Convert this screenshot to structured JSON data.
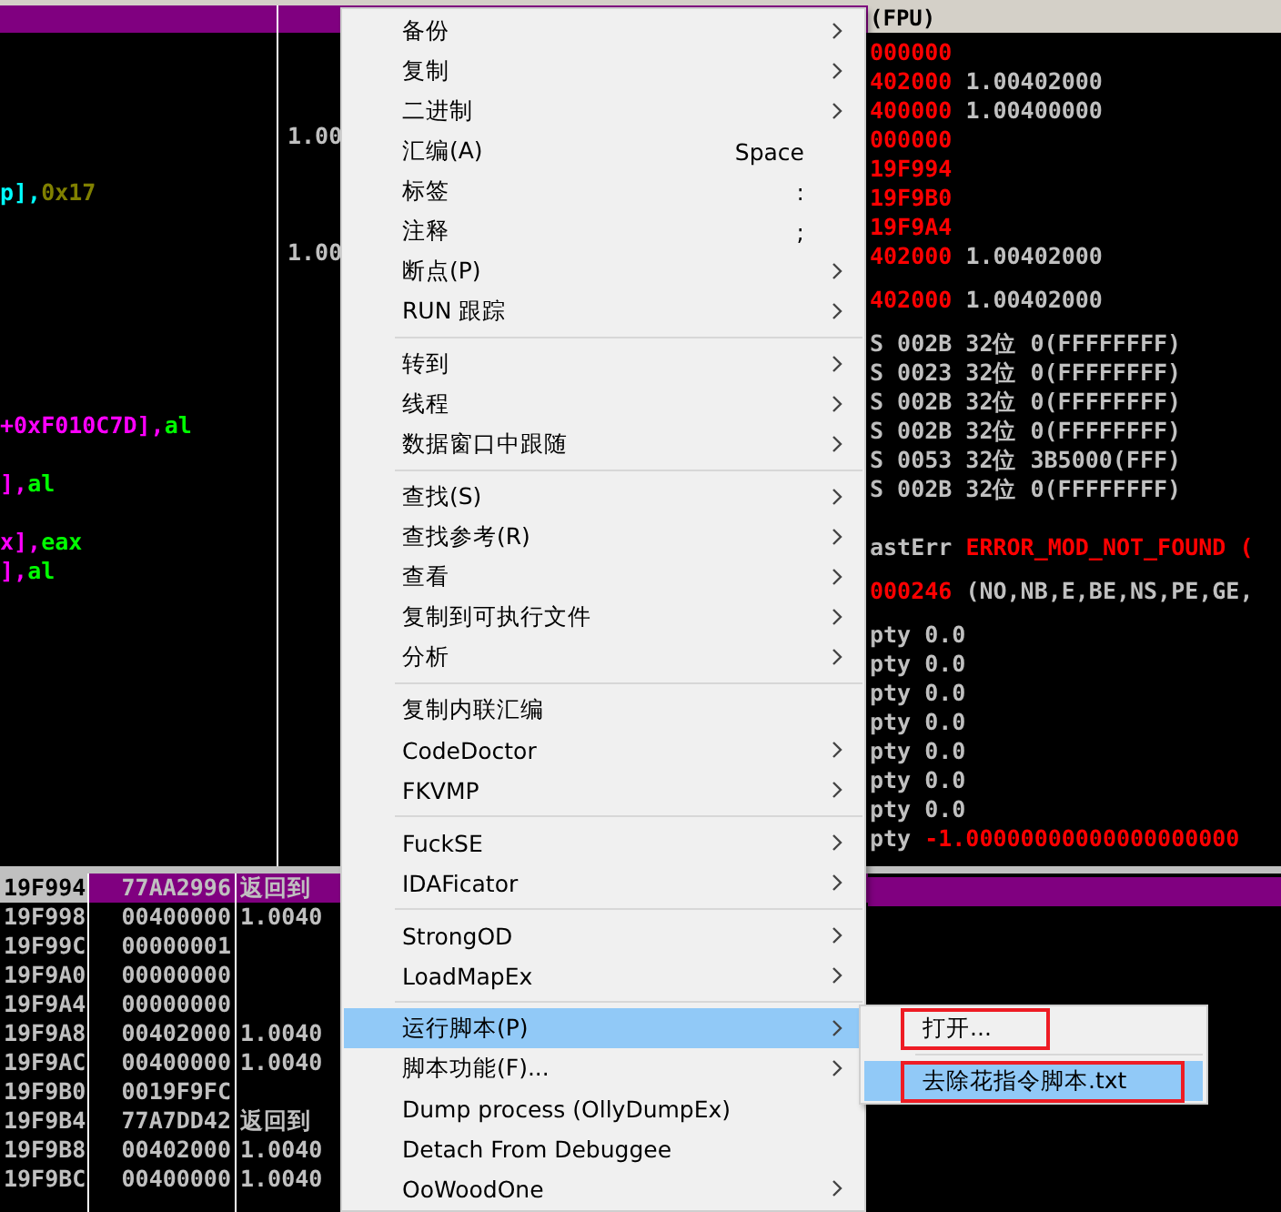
{
  "disassembly": {
    "lines": [
      {
        "kind": "blank"
      },
      {
        "kind": "blank"
      },
      {
        "kind": "blank"
      },
      {
        "kind": "blank"
      },
      {
        "kind": "blank"
      },
      {
        "kind": "code",
        "parts": [
          {
            "text": "p],",
            "color": "#00ffff"
          },
          {
            "text": "0x17",
            "color": "#808000"
          }
        ]
      },
      {
        "kind": "blank"
      },
      {
        "kind": "blank"
      },
      {
        "kind": "blank"
      },
      {
        "kind": "blank"
      },
      {
        "kind": "blank"
      },
      {
        "kind": "blank"
      },
      {
        "kind": "blank"
      },
      {
        "kind": "code",
        "parts": [
          {
            "text": "+0xF010C7D],",
            "color": "#ff00ff"
          },
          {
            "text": "al",
            "color": "#00ff00"
          }
        ]
      },
      {
        "kind": "blank"
      },
      {
        "kind": "code",
        "parts": [
          {
            "text": "],",
            "color": "#ff00ff"
          },
          {
            "text": "al",
            "color": "#00ff00"
          }
        ]
      },
      {
        "kind": "blank"
      },
      {
        "kind": "code",
        "parts": [
          {
            "text": "x],",
            "color": "#ff00ff"
          },
          {
            "text": "eax",
            "color": "#00ff00"
          }
        ]
      },
      {
        "kind": "code",
        "parts": [
          {
            "text": "],",
            "color": "#ff00ff"
          },
          {
            "text": "al",
            "color": "#00ff00"
          }
        ]
      }
    ]
  },
  "info_pane": {
    "lines": [
      {
        "kind": "blank"
      },
      {
        "kind": "blank"
      },
      {
        "kind": "blank"
      },
      {
        "kind": "code",
        "parts": [
          {
            "text": "1.00",
            "color": "#c0c0c0"
          }
        ]
      },
      {
        "kind": "blank"
      },
      {
        "kind": "blank"
      },
      {
        "kind": "blank"
      },
      {
        "kind": "code",
        "parts": [
          {
            "text": "1.00",
            "color": "#c0c0c0"
          }
        ]
      }
    ]
  },
  "registers": {
    "header": "(FPU)",
    "lines": [
      {
        "kind": "code",
        "parts": [
          {
            "text": "000000",
            "color": "#ff0000"
          }
        ]
      },
      {
        "kind": "code",
        "parts": [
          {
            "text": "402000 ",
            "color": "#ff0000"
          },
          {
            "text": "1.00402000",
            "color": "#c0c0c0"
          }
        ]
      },
      {
        "kind": "code",
        "parts": [
          {
            "text": "400000 ",
            "color": "#ff0000"
          },
          {
            "text": "1.00400000",
            "color": "#c0c0c0"
          }
        ]
      },
      {
        "kind": "code",
        "parts": [
          {
            "text": "000000",
            "color": "#ff0000"
          }
        ]
      },
      {
        "kind": "code",
        "parts": [
          {
            "text": "19F994",
            "color": "#ff0000"
          }
        ]
      },
      {
        "kind": "code",
        "parts": [
          {
            "text": "19F9B0",
            "color": "#ff0000"
          }
        ]
      },
      {
        "kind": "code",
        "parts": [
          {
            "text": "19F9A4",
            "color": "#ff0000"
          }
        ]
      },
      {
        "kind": "code",
        "parts": [
          {
            "text": "402000 ",
            "color": "#ff0000"
          },
          {
            "text": "1.00402000",
            "color": "#c0c0c0"
          }
        ]
      },
      {
        "kind": "gap"
      },
      {
        "kind": "code",
        "parts": [
          {
            "text": "402000 ",
            "color": "#ff0000"
          },
          {
            "text": "1.00402000",
            "color": "#c0c0c0"
          }
        ]
      },
      {
        "kind": "gap"
      },
      {
        "kind": "code",
        "parts": [
          {
            "text": "S 002B 32位 0(FFFFFFFF)",
            "color": "#c0c0c0"
          }
        ]
      },
      {
        "kind": "code",
        "parts": [
          {
            "text": "S 0023 32位 0(FFFFFFFF)",
            "color": "#c0c0c0"
          }
        ]
      },
      {
        "kind": "code",
        "parts": [
          {
            "text": "S 002B 32位 0(FFFFFFFF)",
            "color": "#c0c0c0"
          }
        ]
      },
      {
        "kind": "code",
        "parts": [
          {
            "text": "S 002B 32位 0(FFFFFFFF)",
            "color": "#c0c0c0"
          }
        ]
      },
      {
        "kind": "code",
        "parts": [
          {
            "text": "S 0053 32位 3B5000(FFF)",
            "color": "#c0c0c0"
          }
        ]
      },
      {
        "kind": "code",
        "parts": [
          {
            "text": "S 002B 32位 0(FFFFFFFF)",
            "color": "#c0c0c0"
          }
        ]
      },
      {
        "kind": "blank"
      },
      {
        "kind": "code",
        "parts": [
          {
            "text": "astErr ",
            "color": "#c0c0c0"
          },
          {
            "text": "ERROR_MOD_NOT_FOUND (",
            "color": "#ff0000"
          }
        ]
      },
      {
        "kind": "gap"
      },
      {
        "kind": "code",
        "parts": [
          {
            "text": "000246 ",
            "color": "#ff0000"
          },
          {
            "text": "(NO,NB,E,BE,NS,PE,GE,",
            "color": "#c0c0c0"
          }
        ]
      },
      {
        "kind": "gap"
      },
      {
        "kind": "code",
        "parts": [
          {
            "text": "pty 0.0",
            "color": "#c0c0c0"
          }
        ]
      },
      {
        "kind": "code",
        "parts": [
          {
            "text": "pty 0.0",
            "color": "#c0c0c0"
          }
        ]
      },
      {
        "kind": "code",
        "parts": [
          {
            "text": "pty 0.0",
            "color": "#c0c0c0"
          }
        ]
      },
      {
        "kind": "code",
        "parts": [
          {
            "text": "pty 0.0",
            "color": "#c0c0c0"
          }
        ]
      },
      {
        "kind": "code",
        "parts": [
          {
            "text": "pty 0.0",
            "color": "#c0c0c0"
          }
        ]
      },
      {
        "kind": "code",
        "parts": [
          {
            "text": "pty 0.0",
            "color": "#c0c0c0"
          }
        ]
      },
      {
        "kind": "code",
        "parts": [
          {
            "text": "pty 0.0",
            "color": "#c0c0c0"
          }
        ]
      },
      {
        "kind": "code",
        "parts": [
          {
            "text": "pty ",
            "color": "#c0c0c0"
          },
          {
            "text": "-1.00000000000000000000",
            "color": "#ff0000"
          }
        ]
      }
    ]
  },
  "stack": {
    "rows": [
      {
        "address": "19F994",
        "value": "77AA2996",
        "comment": "返回到",
        "selected": true
      },
      {
        "address": "19F998",
        "value": "00400000",
        "comment": "1.0040",
        "selected": false
      },
      {
        "address": "19F99C",
        "value": "00000001",
        "selected": false
      },
      {
        "address": "19F9A0",
        "value": "00000000",
        "selected": false
      },
      {
        "address": "19F9A4",
        "value": "00000000",
        "selected": false
      },
      {
        "address": "19F9A8",
        "value": "00402000",
        "comment": "1.0040",
        "selected": false
      },
      {
        "address": "19F9AC",
        "value": "00400000",
        "comment": "1.0040",
        "selected": false
      },
      {
        "address": "19F9B0",
        "value": "0019F9FC",
        "selected": false
      },
      {
        "address": "19F9B4",
        "value": "77A7DD42",
        "comment": "返回到",
        "selected": false
      },
      {
        "address": "19F9B8",
        "value": "00402000",
        "comment": "1.0040",
        "selected": false
      },
      {
        "address": "19F9BC",
        "value": "00400000",
        "comment": "1.0040",
        "selected": false
      }
    ]
  },
  "context_menu": {
    "items": [
      {
        "kind": "item",
        "label": "备份",
        "submenu": true,
        "selected": false
      },
      {
        "kind": "item",
        "label": "复制",
        "submenu": true,
        "selected": false
      },
      {
        "kind": "item",
        "label": "二进制",
        "submenu": true,
        "selected": false
      },
      {
        "kind": "item",
        "label": "汇编(A)",
        "shortcut": "Space",
        "submenu": false,
        "selected": false
      },
      {
        "kind": "item",
        "label": "标签",
        "shortcut": ":",
        "submenu": false,
        "selected": false
      },
      {
        "kind": "item",
        "label": "注释",
        "shortcut": ";",
        "submenu": false,
        "selected": false
      },
      {
        "kind": "item",
        "label": "断点(P)",
        "submenu": true,
        "selected": false
      },
      {
        "kind": "item",
        "label": "RUN 跟踪",
        "submenu": true,
        "selected": false
      },
      {
        "kind": "separator"
      },
      {
        "kind": "item",
        "label": "转到",
        "submenu": true,
        "selected": false
      },
      {
        "kind": "item",
        "label": "线程",
        "submenu": true,
        "selected": false
      },
      {
        "kind": "item",
        "label": "数据窗口中跟随",
        "submenu": true,
        "selected": false
      },
      {
        "kind": "separator"
      },
      {
        "kind": "item",
        "label": "查找(S)",
        "submenu": true,
        "selected": false
      },
      {
        "kind": "item",
        "label": "查找参考(R)",
        "submenu": true,
        "selected": false
      },
      {
        "kind": "item",
        "label": "查看",
        "submenu": true,
        "selected": false
      },
      {
        "kind": "item",
        "label": "复制到可执行文件",
        "submenu": true,
        "selected": false
      },
      {
        "kind": "item",
        "label": "分析",
        "submenu": true,
        "selected": false
      },
      {
        "kind": "separator"
      },
      {
        "kind": "item",
        "label": "复制内联汇编",
        "submenu": false,
        "selected": false
      },
      {
        "kind": "item",
        "label": "CodeDoctor",
        "submenu": true,
        "selected": false
      },
      {
        "kind": "item",
        "label": "FKVMP",
        "submenu": true,
        "selected": false
      },
      {
        "kind": "separator"
      },
      {
        "kind": "item",
        "label": "FuckSE",
        "submenu": true,
        "selected": false
      },
      {
        "kind": "item",
        "label": "IDAFicator",
        "submenu": true,
        "selected": false
      },
      {
        "kind": "separator"
      },
      {
        "kind": "item",
        "label": "StrongOD",
        "submenu": true,
        "selected": false
      },
      {
        "kind": "item",
        "label": "LoadMapEx",
        "submenu": true,
        "selected": false
      },
      {
        "kind": "separator"
      },
      {
        "kind": "item",
        "label": "运行脚本(P)",
        "submenu": true,
        "selected": true
      },
      {
        "kind": "item",
        "label": "脚本功能(F)...",
        "submenu": true,
        "selected": false
      },
      {
        "kind": "item",
        "label": "Dump process (OllyDumpEx)",
        "submenu": false,
        "selected": false
      },
      {
        "kind": "item",
        "label": "Detach From Debuggee",
        "submenu": false,
        "selected": false
      },
      {
        "kind": "item",
        "label": "OoWoodOne",
        "submenu": true,
        "selected": false
      }
    ]
  },
  "submenu": {
    "items": [
      {
        "kind": "item",
        "label": "打开...",
        "selected": false,
        "outlined": true
      },
      {
        "kind": "separator"
      },
      {
        "kind": "item",
        "label": "去除花指令脚本.txt",
        "selected": true,
        "outlined": true
      }
    ]
  }
}
